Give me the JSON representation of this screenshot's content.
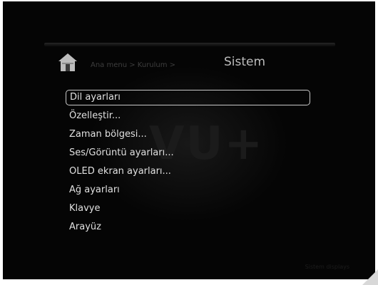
{
  "header": {
    "breadcrumb": "Ana menu > Kurulum >",
    "title": "Sistem",
    "icon": "home-icon"
  },
  "menu": {
    "items": [
      {
        "label": "Dil ayarları",
        "selected": true
      },
      {
        "label": "Özelleştir...",
        "selected": false
      },
      {
        "label": "Zaman bölgesi...",
        "selected": false
      },
      {
        "label": "Ses/Görüntü ayarları...",
        "selected": false
      },
      {
        "label": "OLED ekran ayarları...",
        "selected": false
      },
      {
        "label": "Ağ ayarları",
        "selected": false
      },
      {
        "label": "Klavye",
        "selected": false
      },
      {
        "label": "Arayüz",
        "selected": false
      }
    ]
  },
  "watermark": "VU+",
  "corner_text": "Sistem displays",
  "colors": {
    "background": "#050505",
    "text": "#e0e0e0",
    "selection_border": "#c8c8c8",
    "breadcrumb": "#3e3e3e"
  }
}
